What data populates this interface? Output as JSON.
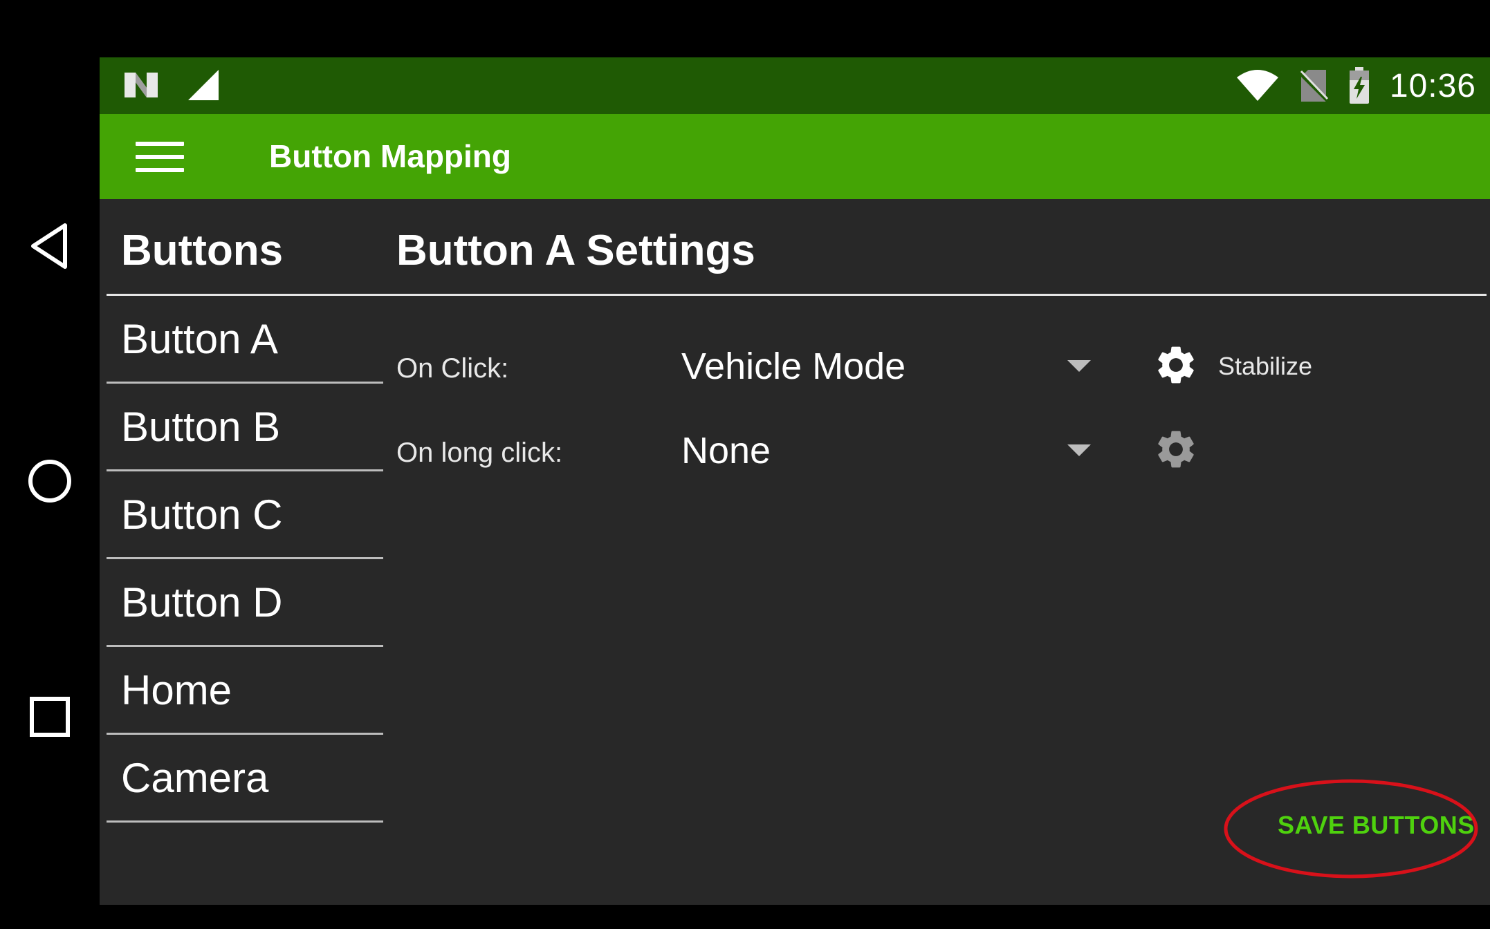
{
  "status_bar": {
    "time": "10:36",
    "icons": [
      "nfc-icon",
      "cellular-signal-icon",
      "wifi-icon",
      "no-sim-icon",
      "battery-charging-icon"
    ]
  },
  "app_bar": {
    "title": "Button Mapping",
    "menu_icon": "hamburger-menu-icon"
  },
  "buttons_panel": {
    "header": "Buttons",
    "items": [
      {
        "label": "Button A"
      },
      {
        "label": "Button B"
      },
      {
        "label": "Button C"
      },
      {
        "label": "Button D"
      },
      {
        "label": "Home"
      },
      {
        "label": "Camera"
      }
    ]
  },
  "settings_panel": {
    "header": "Button A Settings",
    "on_click": {
      "label": "On Click:",
      "value": "Vehicle Mode",
      "gear_caption": "Stabilize"
    },
    "on_long_click": {
      "label": "On long click:",
      "value": "None",
      "gear_caption": ""
    },
    "save_label": "SAVE BUTTONS"
  },
  "colors": {
    "status_bar": "#1f5a04",
    "app_bar": "#44a405",
    "background": "#282828",
    "accent": "#4fd20e",
    "annotation": "#d8111a"
  },
  "nav_bar": {
    "icons": [
      "back-icon",
      "home-icon",
      "recents-icon"
    ]
  }
}
